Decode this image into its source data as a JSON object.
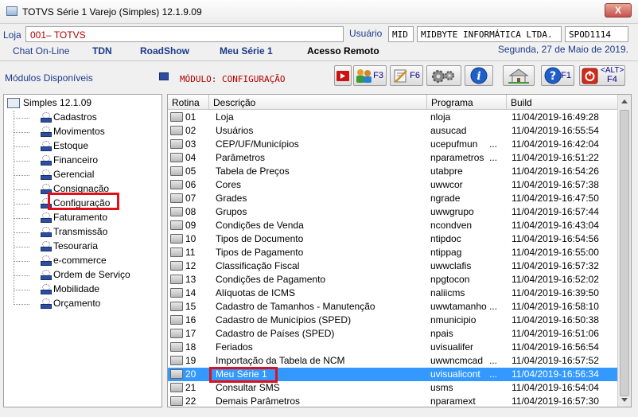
{
  "window": {
    "title": "TOTVS Série 1 Varejo (Simples) 12.1.9.09",
    "close_label": "X"
  },
  "header": {
    "loja_label": "Loja",
    "loja_value": "001–  TOTVS",
    "usuario_label": "Usuário",
    "user_code": "MID",
    "user_company": "MIDBYTE INFORMÁTICA LTDA.",
    "station": "SPOD1114"
  },
  "links": {
    "chat": "Chat On-Line",
    "tdn": "TDN",
    "roadshow": "RoadShow",
    "meu_serie": "Meu Série 1",
    "acesso_remoto": "Acesso Remoto",
    "date": "Segunda, 27 de Maio de 2019."
  },
  "modules_bar": {
    "modulos_label": "Módulos Disponíveis",
    "modulo_current": "MÓDULO: CONFIGURAÇÃO",
    "keys": {
      "f3": "F3",
      "f6": "F6",
      "f1": "F1",
      "alt": "<ALT>",
      "f4": "F4"
    }
  },
  "tree": {
    "root": "Simples 12.1.09",
    "items": [
      "Cadastros",
      "Movimentos",
      "Estoque",
      "Financeiro",
      "Gerencial",
      "Consignação",
      "Configuração",
      "Faturamento",
      "Transmissão",
      "Tesouraria",
      "e-commerce",
      "Ordem de Serviço",
      "Mobilidade",
      "Orçamento"
    ]
  },
  "table": {
    "headers": [
      "Rotina",
      "Descrição",
      "Programa",
      "Build"
    ],
    "rows": [
      [
        "01",
        "Loja",
        "nloja",
        "11/04/2019-16:49:28"
      ],
      [
        "02",
        "Usuários",
        "ausucad",
        "11/04/2019-16:55:54"
      ],
      [
        "03",
        "CEP/UF/Municípios",
        "ucepufmun",
        "11/04/2019-16:42:04"
      ],
      [
        "04",
        "Parâmetros",
        "nparametros",
        "11/04/2019-16:51:22"
      ],
      [
        "05",
        "Tabela de Preços",
        "utabpre",
        "11/04/2019-16:54:26"
      ],
      [
        "06",
        "Cores",
        "uwwcor",
        "11/04/2019-16:57:38"
      ],
      [
        "07",
        "Grades",
        "ngrade",
        "11/04/2019-16:47:50"
      ],
      [
        "08",
        "Grupos",
        "uwwgrupo",
        "11/04/2019-16:57:44"
      ],
      [
        "09",
        "Condições de Venda",
        "ncondven",
        "11/04/2019-16:43:04"
      ],
      [
        "10",
        "Tipos de Documento",
        "ntipdoc",
        "11/04/2019-16:54:56"
      ],
      [
        "11",
        "Tipos de Pagamento",
        "ntippag",
        "11/04/2019-16:55:00"
      ],
      [
        "12",
        "Classificação Fiscal",
        "uwwclafis",
        "11/04/2019-16:57:32"
      ],
      [
        "13",
        "Condições de Pagamento",
        "npgtocon",
        "11/04/2019-16:52:02"
      ],
      [
        "14",
        "Alíquotas de ICMS",
        "naliicms",
        "11/04/2019-16:39:50"
      ],
      [
        "15",
        "Cadastro de Tamanhos - Manutenção",
        "uwwtamanho",
        "11/04/2019-16:58:10"
      ],
      [
        "16",
        "Cadastro de Municípios (SPED)",
        "nmunicipio",
        "11/04/2019-16:50:38"
      ],
      [
        "17",
        "Cadastro de Países (SPED)",
        "npais",
        "11/04/2019-16:51:06"
      ],
      [
        "18",
        "Feriados",
        "uvisualifer",
        "11/04/2019-16:56:54"
      ],
      [
        "19",
        "Importação da Tabela de NCM",
        "uwwncmcad",
        "11/04/2019-16:57:52"
      ],
      [
        "20",
        "Meu Série 1",
        "uvisualicont",
        "11/04/2019-16:56:34"
      ],
      [
        "21",
        "Consultar SMS",
        "usms",
        "11/04/2019-16:54:04"
      ],
      [
        "22",
        "Demais Parâmetros",
        "nparamext",
        "11/04/2019-16:57:30"
      ]
    ],
    "ellipsis": "...",
    "selected_index": 19
  }
}
